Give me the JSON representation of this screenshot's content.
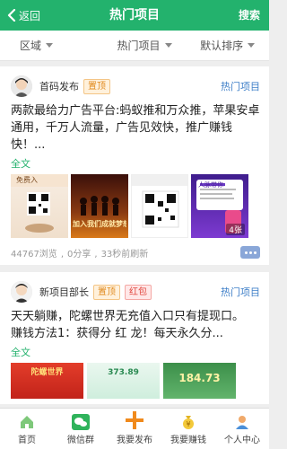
{
  "header": {
    "back_label": "返回",
    "title": "热门项目",
    "search_label": "搜索"
  },
  "filters": [
    {
      "label": "区域"
    },
    {
      "label": "热门项目"
    },
    {
      "label": "默认排序"
    }
  ],
  "posts": [
    {
      "author": "首码发布",
      "badges": [
        "置顶"
      ],
      "category": "热门项目",
      "text": "两款最给力广告平台:蚂蚁推和万众推，苹果安卓通用，千万人流量，广告见效快，推广赚钱快！...",
      "more_label": "全文",
      "thumbs": [
        {
          "caption": "免费入"
        },
        {
          "caption": "加入我们成就梦想"
        },
        {
          "caption": ""
        },
        {
          "caption": "人脉带你",
          "count_label": "4张"
        }
      ],
      "views": "44767浏览",
      "shares": "0分享",
      "time": "33秒前刷新"
    },
    {
      "author": "新项目部长",
      "badges": [
        "置顶",
        "红包"
      ],
      "category": "热门项目",
      "text_lines": [
        "天天躺赚，陀螺世界无充值入口只有提现口。",
        "赚钱方法1：获得分 红 龙！每天永久分..."
      ],
      "more_label": "全文",
      "thumbs": [
        {
          "caption": "陀螺世界"
        },
        {
          "caption": "373.89"
        },
        {
          "caption": "184.73"
        }
      ]
    }
  ],
  "nav": [
    {
      "label": "首页"
    },
    {
      "label": "微信群"
    },
    {
      "label": "我要发布"
    },
    {
      "label": "我要赚钱"
    },
    {
      "label": "个人中心"
    }
  ],
  "colors": {
    "brand": "#23b26d",
    "link": "#3f7fc8",
    "accent_orange": "#e08a1e",
    "accent_red": "#e0443c"
  }
}
